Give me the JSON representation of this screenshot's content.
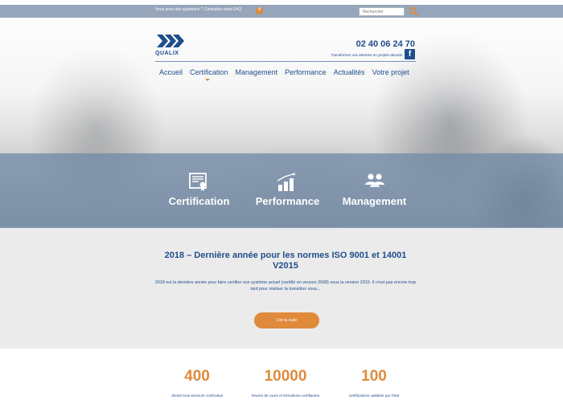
{
  "topbar": {
    "faq_text": "Vous avez des questions ? Consultez notre FAQ",
    "faq_icon": "?",
    "search_placeholder": "Rechercher"
  },
  "header": {
    "logo_text": "QUALIX",
    "phone": "02 40 06 24 70",
    "tagline": "Transformer vos attentes en projets aboutis",
    "facebook_icon": "f"
  },
  "nav": {
    "items": [
      "Accueil",
      "Certification",
      "Management",
      "Performance",
      "Actualités",
      "Votre projet"
    ]
  },
  "services": [
    {
      "label": "Certification",
      "icon": "certificate-icon"
    },
    {
      "label": "Performance",
      "icon": "bar-chart-icon"
    },
    {
      "label": "Management",
      "icon": "team-icon"
    }
  ],
  "news": {
    "title": "2018 – Dernière année pour les normes ISO 9001 et 14001 V2015",
    "body": "2018 est la dernière année pour faire certifier son système actuel (certifié en version 2008) sous la version 2015.  Il n'est pas encore trop tard pour réaliser la transition sous...",
    "button_label": "Lire la suite"
  },
  "stats": [
    {
      "value": "400",
      "label": "clients tous secteurs confondus"
    },
    {
      "value": "10000",
      "label": "heures de cours et formations certifiantes"
    },
    {
      "value": "100",
      "label": "certifications validées par l'état"
    }
  ],
  "colors": {
    "brand_blue": "#1f4e8c",
    "accent_orange": "#e08a3c",
    "band_blue": "#738ca8"
  }
}
